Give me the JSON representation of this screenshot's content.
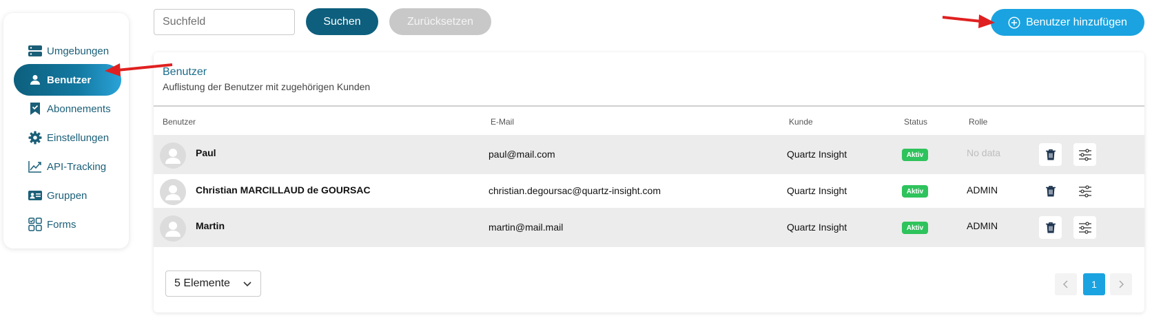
{
  "sidebar": {
    "items": [
      {
        "label": "Umgebungen",
        "icon": "server-icon",
        "active": false
      },
      {
        "label": "Benutzer",
        "icon": "user-icon",
        "active": true
      },
      {
        "label": "Abonnements",
        "icon": "bookmark-icon",
        "active": false
      },
      {
        "label": "Einstellungen",
        "icon": "gear-icon",
        "active": false
      },
      {
        "label": "API-Tracking",
        "icon": "chart-line-icon",
        "active": false
      },
      {
        "label": "Gruppen",
        "icon": "id-card-icon",
        "active": false
      },
      {
        "label": "Forms",
        "icon": "grid-icon",
        "active": false
      }
    ]
  },
  "toolbar": {
    "search_placeholder": "Suchfeld",
    "search_label": "Suchen",
    "reset_label": "Zurücksetzen",
    "add_label": "Benutzer hinzufügen"
  },
  "card": {
    "title": "Benutzer",
    "subtitle": "Auflistung der Benutzer mit zugehörigen Kunden",
    "columns": {
      "user": "Benutzer",
      "email": "E-Mail",
      "kunde": "Kunde",
      "status": "Status",
      "rolle": "Rolle"
    },
    "rows": [
      {
        "name": "Paul",
        "email": "paul@mail.com",
        "kunde": "Quartz Insight",
        "status": "Aktiv",
        "rolle": "No data"
      },
      {
        "name": "Christian MARCILLAUD de GOURSAC",
        "email": "christian.degoursac@quartz-insight.com",
        "kunde": "Quartz Insight",
        "status": "Aktiv",
        "rolle": "ADMIN"
      },
      {
        "name": "Martin",
        "email": "martin@mail.mail",
        "kunde": "Quartz Insight",
        "status": "Aktiv",
        "rolle": "ADMIN"
      }
    ],
    "page_size": "5 Elemente",
    "current_page": "1"
  },
  "colors": {
    "primary": "#0d5f7d",
    "accent": "#1aa3e0",
    "active_badge": "#2ec35c",
    "annotation_arrow": "#e02020"
  }
}
